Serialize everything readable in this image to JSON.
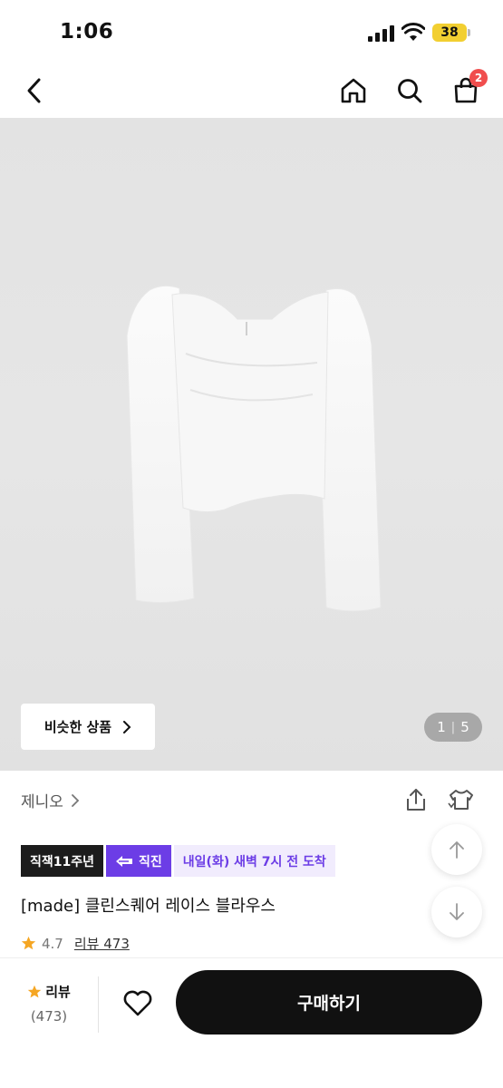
{
  "status": {
    "time": "1:06",
    "battery": "38"
  },
  "header": {
    "cart_count": "2",
    "back_icon": "chevron-left-icon",
    "home_icon": "home-icon",
    "search_icon": "search-icon",
    "cart_icon": "shopping-bag-icon"
  },
  "image": {
    "similar_label": "비슷한 상품",
    "page_current": "1",
    "page_total": "5"
  },
  "brand": {
    "name": "제니오"
  },
  "badges": {
    "anniversary": "직잭11주년",
    "direct": "직진",
    "delivery": "내일(화) 새벽 7시 전 도착"
  },
  "product": {
    "title": "[made] 클린스퀘어 레이스 블라우스",
    "rating": "4.7",
    "review_label": "리뷰 473"
  },
  "bottom": {
    "review_label": "리뷰",
    "review_count": "(473)",
    "buy_label": "구매하기"
  },
  "colors": {
    "accent": "#6c3de6",
    "star": "#f5a623",
    "badge": "#f04e4e"
  }
}
